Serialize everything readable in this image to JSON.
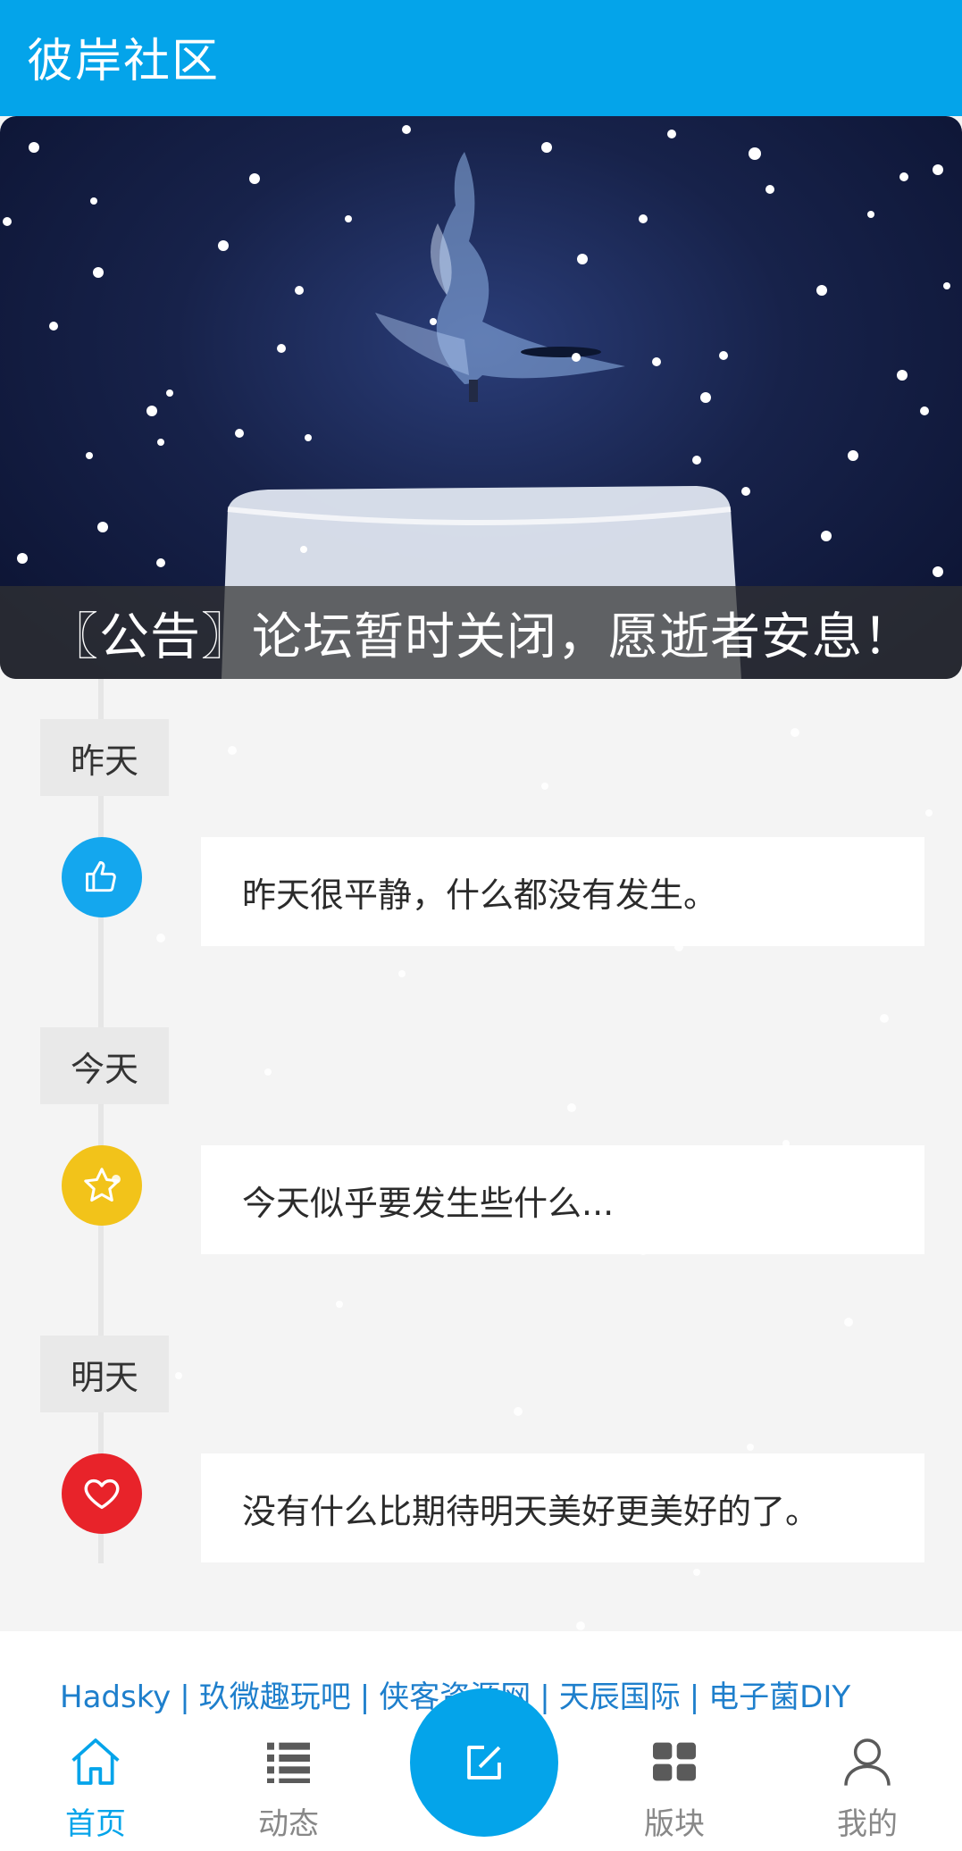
{
  "header": {
    "title": "彼岸社区"
  },
  "banner": {
    "caption": "〖公告〗论坛暂时关闭，愿逝者安息！"
  },
  "timeline": [
    {
      "day": "昨天",
      "icon": "thumbs-up-icon",
      "color": "#14a7ee",
      "text": "昨天很平静，什么都没有发生。"
    },
    {
      "day": "今天",
      "icon": "star-icon",
      "color": "#f2c31a",
      "text": "今天似乎要发生些什么..."
    },
    {
      "day": "明天",
      "icon": "heart-icon",
      "color": "#e8232a",
      "text": "没有什么比期待明天美好更美好的了。"
    }
  ],
  "footer_links": [
    "Hadsky",
    "玖微趣玩吧",
    "侠客资源网",
    "天辰国际",
    "电子菌DIY"
  ],
  "nav": {
    "items": [
      {
        "label": "首页",
        "icon": "home-icon",
        "active": true
      },
      {
        "label": "动态",
        "icon": "list-icon",
        "active": false
      },
      {
        "label": "版块",
        "icon": "grid-icon",
        "active": false
      },
      {
        "label": "我的",
        "icon": "user-icon",
        "active": false
      }
    ],
    "fab_icon": "compose-icon"
  },
  "colors": {
    "primary": "#04a4ea",
    "link": "#1e7fcc",
    "background": "#f4f4f4"
  }
}
